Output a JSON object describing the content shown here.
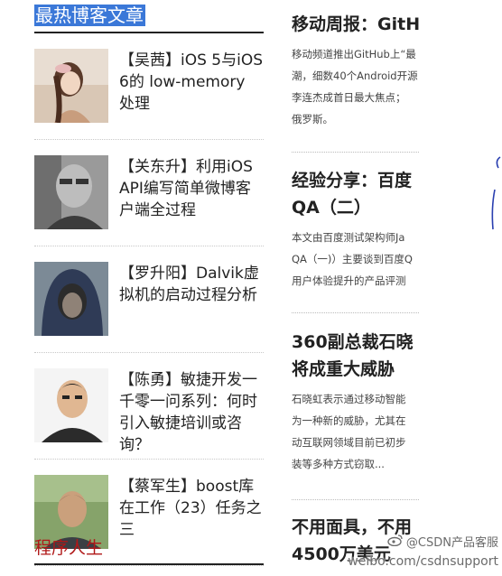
{
  "sidebar": {
    "section_title": "最热博客文章",
    "posts": [
      {
        "title": "【吴茜】iOS 5与iOS 6的 low-memory 处理"
      },
      {
        "title": "【关东升】利用iOS API编写简单微博客户端全过程"
      },
      {
        "title": "【罗升阳】Dalvik虚拟机的启动过程分析"
      },
      {
        "title": "【陈勇】敏捷开发一千零一问系列：何时引入敏捷培训或咨询？"
      },
      {
        "title": "【蔡军生】boost库在工作（23）任务之三"
      }
    ],
    "section2_title": "程序人生"
  },
  "news": [
    {
      "title": "移动周报：GitH",
      "body": [
        "移动频道推出GitHub上“最",
        "潮，细数40个Android开源",
        "李连杰成首日最大焦点；",
        "俄罗斯。"
      ]
    },
    {
      "title": [
        "经验分享：百度",
        "QA（二）"
      ],
      "body": [
        "本文由百度测试架构师Ja",
        "QA（一)）主要谈到百度Q",
        "用户体验提升的产品评测"
      ]
    },
    {
      "title": [
        "360副总裁石晓",
        "将成重大威胁"
      ],
      "body": [
        "石晓虹表示通过移动智能",
        "为一种新的威胁，尤其在",
        "动互联网领域目前已初步",
        "装等多种方式窃取..."
      ]
    },
    {
      "title": [
        "不用面具，不用",
        "4500万美元"
      ],
      "body": []
    }
  ],
  "watermark": {
    "line1": "@CSDN产品客服",
    "line2": "weibo.com/csdnsupport"
  }
}
